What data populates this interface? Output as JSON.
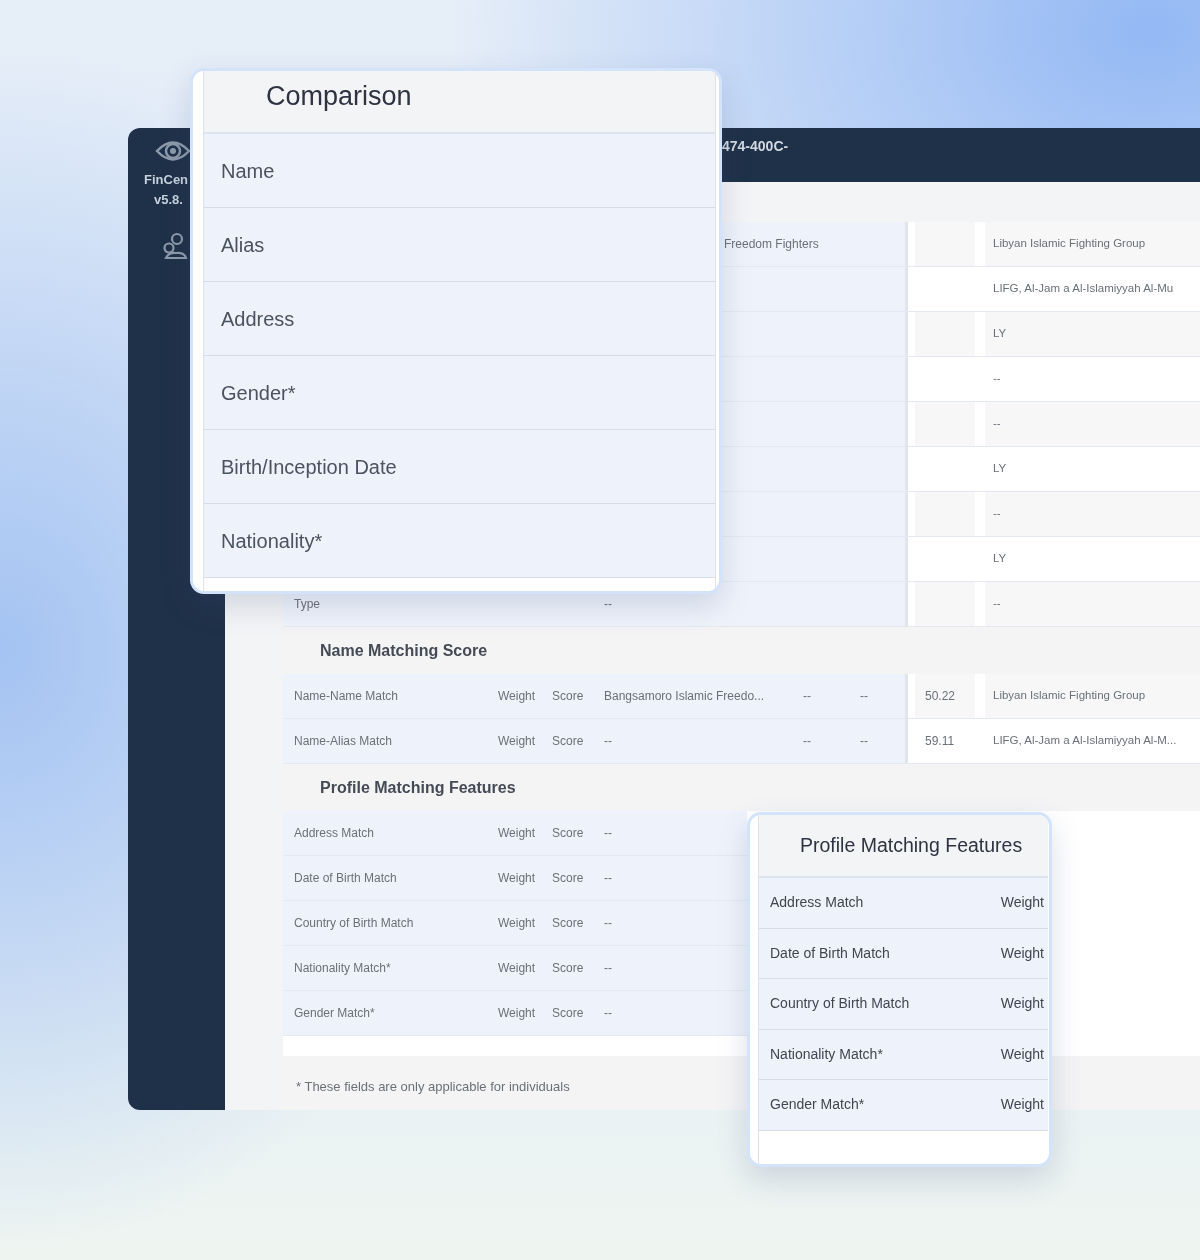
{
  "app": {
    "brand": "FinCen",
    "version": "v5.8.",
    "header_text": "474-400C-"
  },
  "comparison_table": {
    "rows": [
      {
        "value": "Freedom Fighters",
        "match": "Libyan Islamic Fighting Group"
      },
      {
        "match": "LIFG, Al-Jam a Al-Islamiyyah Al-Mu"
      },
      {
        "match": "LY"
      },
      {
        "match": "--"
      },
      {
        "match": "--"
      },
      {
        "match": "LY"
      },
      {
        "match": "--"
      },
      {
        "match": "LY"
      },
      {
        "label": "Type",
        "value": "--",
        "match": "--"
      }
    ]
  },
  "name_matching_score": {
    "title": "Name Matching Score",
    "rows": [
      {
        "label": "Name-Name Match",
        "weight": "Weight",
        "score": "Score",
        "value": "Bangsamoro Islamic Freedo...",
        "column_4": "--",
        "column_5": "--",
        "similarity": "50.22",
        "match": "Libyan Islamic Fighting Group"
      },
      {
        "label": "Name-Alias Match",
        "weight": "Weight",
        "score": "Score",
        "value": "--",
        "column_4": "--",
        "column_5": "--",
        "similarity": "59.11",
        "match": "LIFG, Al-Jam a Al-Islamiyyah Al-M..."
      }
    ]
  },
  "profile_matching_features": {
    "title": "Profile Matching Features",
    "rows": [
      {
        "label": "Address Match",
        "weight": "Weight",
        "score": "Score",
        "value": "--"
      },
      {
        "label": "Date of Birth Match",
        "weight": "Weight",
        "score": "Score",
        "value": "--"
      },
      {
        "label": "Country of Birth Match",
        "weight": "Weight",
        "score": "Score",
        "value": "--"
      },
      {
        "label": "Nationality Match*",
        "weight": "Weight",
        "score": "Score",
        "value": "--"
      },
      {
        "label": "Gender Match*",
        "weight": "Weight",
        "score": "Score",
        "value": "--"
      }
    ]
  },
  "footnote": "* These fields are only applicable for individuals",
  "comparison_card": {
    "title": "Comparison",
    "rows": [
      "Name",
      "Alias",
      "Address",
      "Gender*",
      "Birth/Inception Date",
      "Nationality*"
    ]
  },
  "profile_card": {
    "title": "Profile Matching Features",
    "rows": [
      {
        "label": "Address Match",
        "weight": "Weight"
      },
      {
        "label": "Date of Birth Match",
        "weight": "Weight"
      },
      {
        "label": "Country of Birth Match",
        "weight": "Weight"
      },
      {
        "label": "Nationality Match*",
        "weight": "Weight"
      },
      {
        "label": "Gender Match*",
        "weight": "Weight"
      }
    ]
  }
}
